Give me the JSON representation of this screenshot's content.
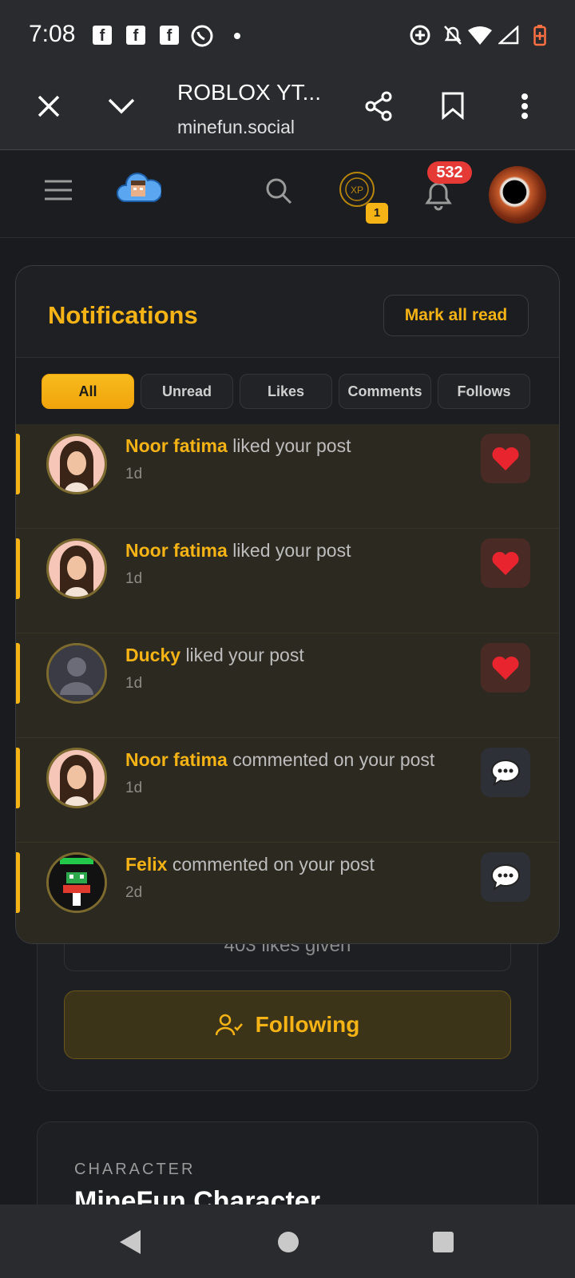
{
  "status": {
    "time": "7:08",
    "fb_letter": "f"
  },
  "browser": {
    "title": "ROBLOX YT...",
    "url": "minefun.social"
  },
  "header": {
    "notif_count": "532",
    "xp_label": "XP",
    "xp_level": "1"
  },
  "notifications": {
    "title": "Notifications",
    "mark_all": "Mark all read",
    "tabs": [
      "All",
      "Unread",
      "Likes",
      "Comments",
      "Follows"
    ],
    "items": [
      {
        "name": "Noor fatima",
        "action": "liked your post",
        "time": "1d",
        "kind": "like"
      },
      {
        "name": "Noor fatima",
        "action": "liked your post",
        "time": "1d",
        "kind": "like"
      },
      {
        "name": "Ducky",
        "action": "liked your post",
        "time": "1d",
        "kind": "like"
      },
      {
        "name": "Noor fatima",
        "action": "commented on your post",
        "time": "1d",
        "kind": "comment"
      },
      {
        "name": "Felix",
        "action": "commented on your post",
        "time": "2d",
        "kind": "comment"
      }
    ]
  },
  "background": {
    "likes_given": "403 likes given",
    "following": "Following",
    "character_label": "CHARACTER",
    "character_title": "MineFun Character"
  },
  "colors": {
    "accent": "#f5b316",
    "badge": "#e53935",
    "panel": "#1f2023"
  },
  "icons": {
    "like": "heart-icon",
    "comment": "speech-bubble-icon"
  }
}
